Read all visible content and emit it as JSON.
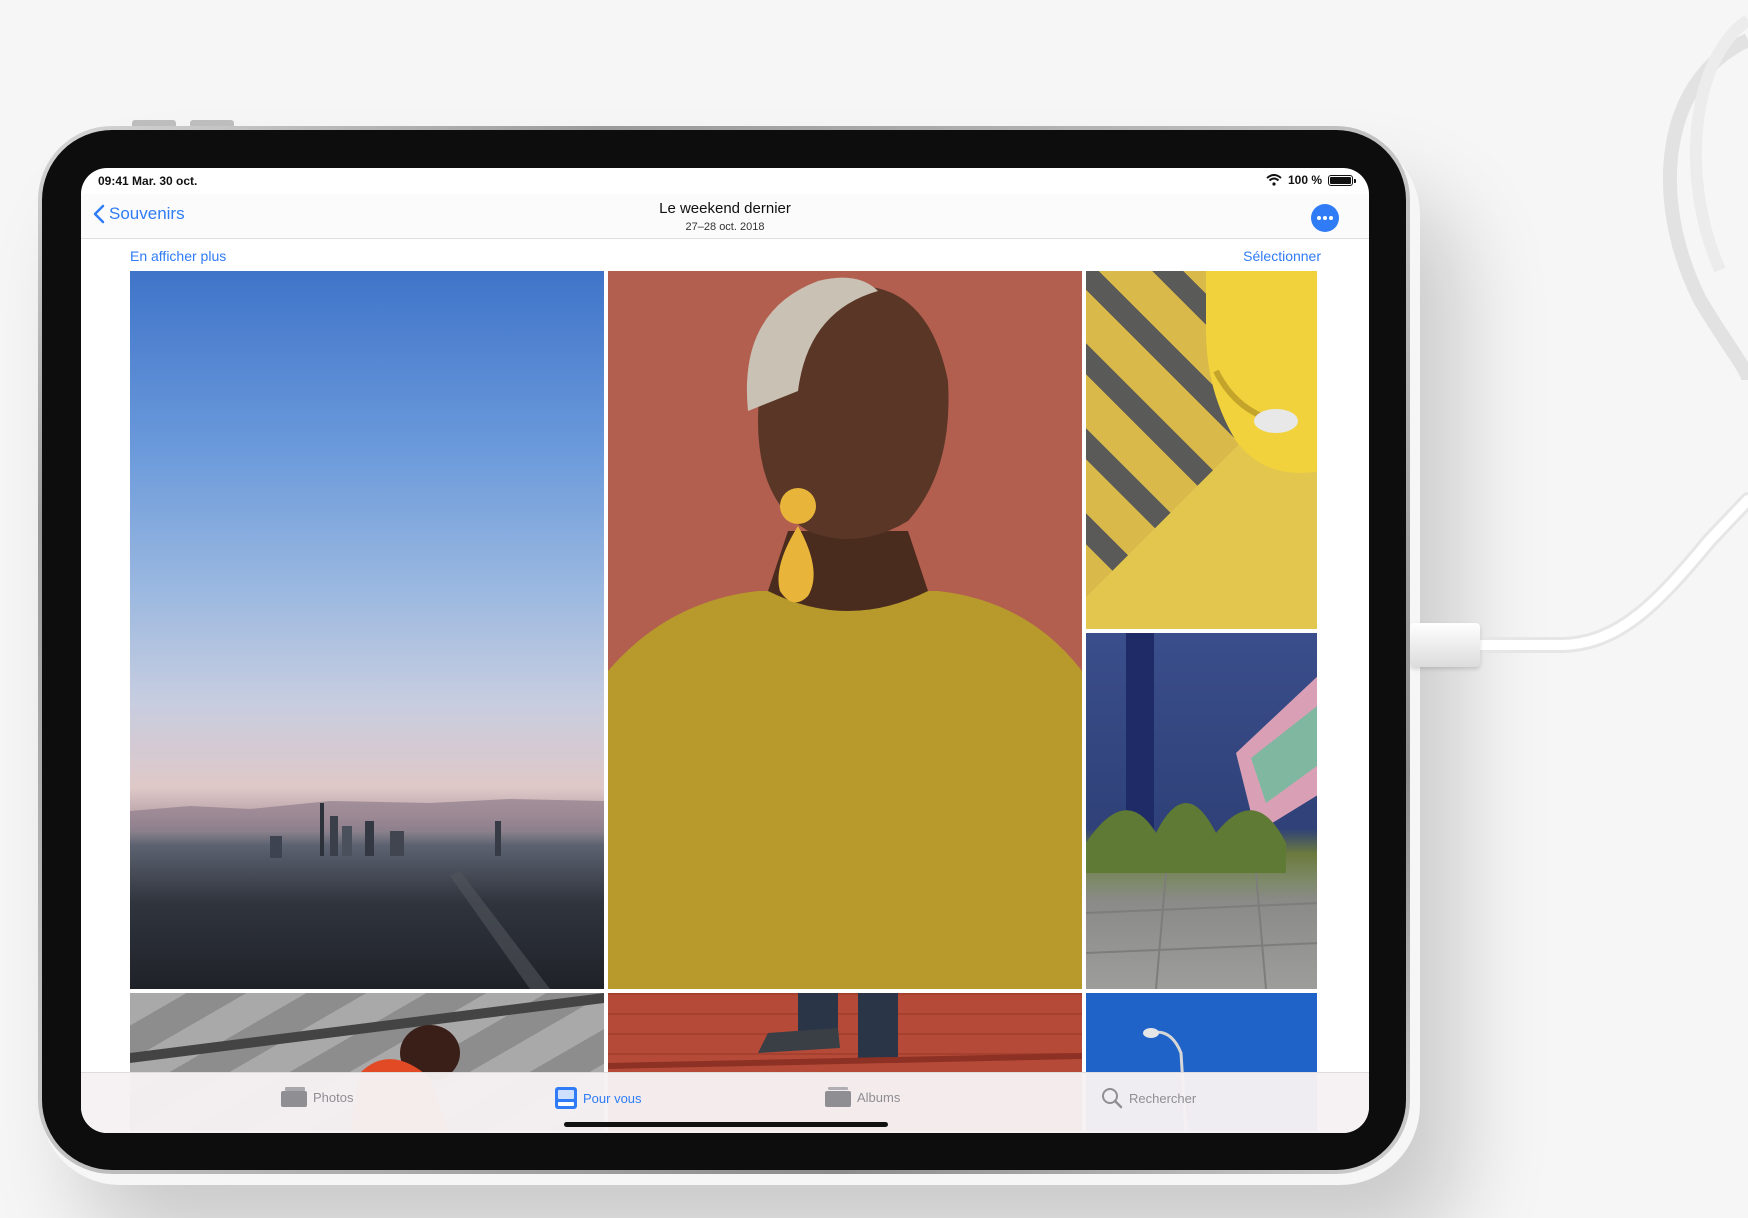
{
  "status_bar": {
    "time_date": "09:41  Mar. 30 oct.",
    "battery": "100 %"
  },
  "nav": {
    "back_label": "Souvenirs",
    "title": "Le weekend dernier",
    "subtitle": "27–28 oct. 2018",
    "more_icon": "ellipsis-icon"
  },
  "actions": {
    "show_more": "En afficher plus",
    "select": "Sélectionner"
  },
  "photos": [
    {
      "subject": "city skyline at sunset"
    },
    {
      "subject": "woman with yellow earrings"
    },
    {
      "subject": "yellow taxi on painted road"
    },
    {
      "subject": "grass by blue brick wall"
    },
    {
      "subject": "girl on concrete stairs"
    },
    {
      "subject": "legs on red brick wall"
    },
    {
      "subject": "street lamp against blue sky"
    }
  ],
  "tabs": [
    {
      "label": "Photos",
      "icon": "photos-icon",
      "active": false
    },
    {
      "label": "Pour vous",
      "icon": "for-you-icon",
      "active": true
    },
    {
      "label": "Albums",
      "icon": "albums-icon",
      "active": false
    },
    {
      "label": "Rechercher",
      "icon": "search-icon",
      "active": false
    }
  ],
  "colors": {
    "accent": "#2f7cf6",
    "inactive_tab": "#8e8e93"
  }
}
